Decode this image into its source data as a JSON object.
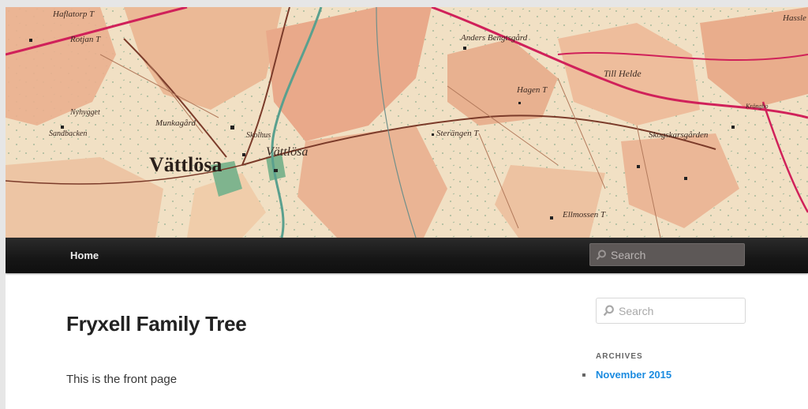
{
  "header": {
    "banner_map_labels": [
      "Haflatorp T",
      "Rotjan T",
      "Nyhygget",
      "Sandbacken",
      "Munkagård",
      "Vättlösa",
      "Skolhus",
      "Vättlösa",
      "Anders Bengtsgård",
      "Hagen T",
      "Till Helde",
      "Skogskarsgården",
      "Sterängen T",
      "Ellmossen T",
      "Hassle",
      "Kröngbo"
    ],
    "accent_color": "#d0215a"
  },
  "nav": {
    "home_label": "Home",
    "search_placeholder": "Search"
  },
  "main": {
    "title": "Fryxell Family Tree",
    "body": "This is the front page"
  },
  "sidebar": {
    "search_placeholder": "Search",
    "archives_title": "ARCHIVES",
    "archives": [
      {
        "label": "November 2015"
      }
    ]
  },
  "icons": {
    "nav_search": "search-icon",
    "sidebar_search": "search-icon"
  }
}
